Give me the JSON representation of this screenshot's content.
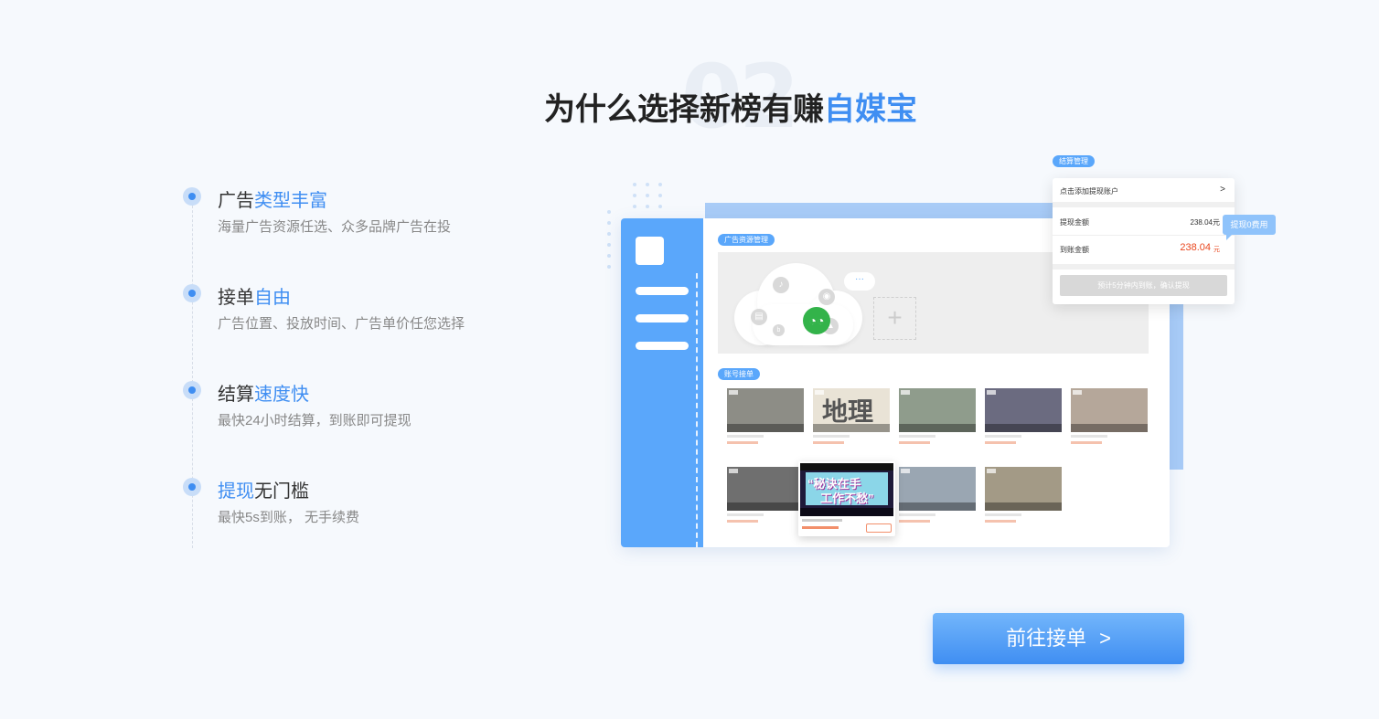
{
  "header": {
    "bg_number": "02",
    "title_plain": "为什么选择新榜有赚",
    "title_highlight": "自媒宝"
  },
  "features": [
    {
      "title_plain": "广告",
      "title_highlight": "类型丰富",
      "desc": "海量广告资源任选、众多品牌广告在投"
    },
    {
      "title_plain": "接单",
      "title_highlight": "自由",
      "desc": "广告位置、投放时间、广告单价任您选择"
    },
    {
      "title_plain": "结算",
      "title_highlight": "速度快",
      "desc": "最快24小时结算，到账即可提现"
    },
    {
      "title_highlight": "提现",
      "title_plain": "无门槛",
      "desc": "最快5s到账， 无手续费"
    }
  ],
  "illustration": {
    "ad_tag": "广告资源管理",
    "order_tag": "账号接单",
    "geo_text": "地理",
    "cloud_chat": "···",
    "add_symbol": "+",
    "popup_line1": "“秘诀在手",
    "popup_line2": "工作不愁”",
    "settle_tag": "结算管理",
    "settle_add_account": "点击添加提现账户",
    "settle_chevron": ">",
    "withdraw_label": "提现金额",
    "withdraw_value": "238.04元",
    "arrive_label": "到账金额",
    "arrive_value": "238.04",
    "arrive_unit": "元",
    "confirm_text": "预计5分钟内到账，确认提现",
    "fee_bubble": "提现0费用"
  },
  "colors": {
    "accent": "#3f8ef2",
    "side": "#5aa7fb",
    "price": "#e9461d",
    "wechat": "#33b34a"
  },
  "cta": {
    "label": "前往接单",
    "chevron": ">"
  }
}
